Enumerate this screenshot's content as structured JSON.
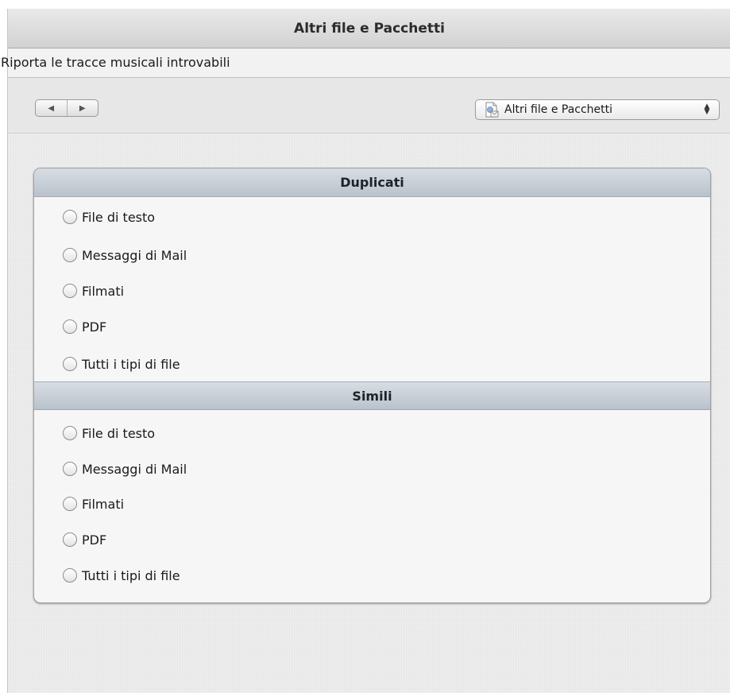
{
  "window": {
    "title": "Altri file e Pacchetti"
  },
  "subtitle": "Riporta le tracce musicali introvabili",
  "toolbar": {
    "back_icon": "triangle-left",
    "forward_icon": "triangle-right",
    "category_popup": {
      "selected": "Altri file e Pacchetti",
      "icon": "document-mail-icon"
    }
  },
  "sections": [
    {
      "header": "Duplicati",
      "options": [
        {
          "label": "File di testo",
          "selected": false
        },
        {
          "label": "Messaggi di Mail",
          "selected": false
        },
        {
          "label": "Filmati",
          "selected": false
        },
        {
          "label": "PDF",
          "selected": false
        },
        {
          "label": "Tutti i tipi di file",
          "selected": false
        }
      ]
    },
    {
      "header": "Simili",
      "options": [
        {
          "label": "File di testo",
          "selected": false
        },
        {
          "label": "Messaggi di Mail",
          "selected": false
        },
        {
          "label": "Filmati",
          "selected": false
        },
        {
          "label": "PDF",
          "selected": false
        },
        {
          "label": "Tutti i tipi di file",
          "selected": false
        }
      ]
    }
  ],
  "colors": {
    "header_gradient_top": "#d8dde3",
    "header_gradient_bottom": "#b9c2cc",
    "panel_bg": "#f6f6f6",
    "window_bg": "#ebebeb"
  }
}
